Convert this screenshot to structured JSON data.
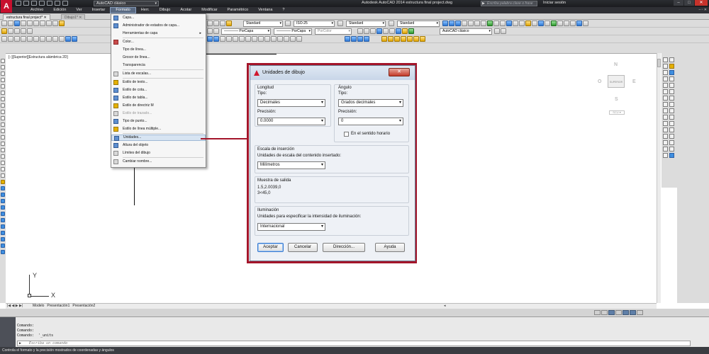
{
  "app": {
    "logo_letter": "A",
    "workspace": "AutoCAD clásico",
    "doc_title": "Autodesk AutoCAD 2014   estructura final project.dwg",
    "search_placeholder": "Escriba palabra clave o frase",
    "login": "Iniciar sesión",
    "win_min": "–",
    "win_max": "□",
    "win_close": "✕"
  },
  "menubar": {
    "items": [
      "Archivo",
      "Edición",
      "Ver",
      "Insertar",
      "Formato",
      "Herr.",
      "Dibujo",
      "Acotar",
      "Modificar",
      "Paramétrico",
      "Ventana",
      "?"
    ],
    "active_index": 4,
    "mdi_controls": "– ▫ ✕"
  },
  "doc_tabs": [
    {
      "label": "estructura final project*  ✕",
      "active": true
    },
    {
      "label": "Dibujo1*  ✕",
      "active": false
    }
  ],
  "toolbars": {
    "layer_combo": "———— PorCapa",
    "linetype_combo": "———— PorCapa",
    "color_combo": "PorColor",
    "text_style": "Standard",
    "dim_style": "ISO-25",
    "table_style": "Standard",
    "mleader_style": "Standard",
    "workspace_combo": "AutoCAD clásico"
  },
  "drawing": {
    "view_label": "[−][Superior][Estructura alámbrica 2D]",
    "ucs_x": "X",
    "ucs_y": "Y"
  },
  "navcube": {
    "top": "SUPERIOR",
    "n": "N",
    "s": "S",
    "e": "E",
    "o": "O",
    "wcs": "SCU ▾"
  },
  "layout_tabs": {
    "nav": "|◀ ◀ ▶ ▶|",
    "tabs": [
      "Modelo",
      "Presentación1",
      "Presentación2"
    ]
  },
  "command": {
    "lines": [
      "Comando:",
      "Comando:",
      "Comando:  '_units"
    ],
    "input_placeholder": "Escriba un comando",
    "input_icon": "▶"
  },
  "statusbar": {
    "text": "Controla el formato y la precisión mostrados de coordenadas y ángulos"
  },
  "formato_menu": {
    "items": [
      {
        "label": "Capa...",
        "icon": "t1"
      },
      {
        "label": "Administrador de estados de capa...",
        "icon": "t1"
      },
      {
        "label": "Herramientas de capa",
        "icon": "",
        "submenu": true
      },
      {
        "label": "Color...",
        "icon": "t4"
      },
      {
        "label": "Tipo de línea...",
        "icon": ""
      },
      {
        "label": "Grosor de línea...",
        "icon": ""
      },
      {
        "label": "Transparencia",
        "icon": ""
      },
      {
        "label": "Lista de escalas...",
        "icon": "t3"
      },
      {
        "label": "Estilo de texto...",
        "icon": "t2"
      },
      {
        "label": "Estilo de cota...",
        "icon": "t1"
      },
      {
        "label": "Estilo de tabla...",
        "icon": "t1"
      },
      {
        "label": "Estilo de directriz M",
        "icon": "t2"
      },
      {
        "label": "Estilo de trazado...",
        "icon": "t3",
        "disabled": true
      },
      {
        "label": "Tipo de punto...",
        "icon": "t1"
      },
      {
        "label": "Estilo de línea múltiple...",
        "icon": "t2"
      },
      {
        "label": "Unidades...",
        "icon": "t1",
        "highlight": true
      },
      {
        "label": "Altura del objeto",
        "icon": "t1"
      },
      {
        "label": "Límites del dibujo",
        "icon": "t3"
      },
      {
        "label": "Cambiar nombre...",
        "icon": "t3"
      }
    ]
  },
  "dialog": {
    "title": "Unidades de dibujo",
    "close_label": "✕",
    "length": {
      "heading": "Longitud",
      "type_label": "Tipo:",
      "type_value": "Decimales",
      "precision_label": "Precisión:",
      "precision_value": "0.0000"
    },
    "angle": {
      "heading": "Ángulo",
      "type_label": "Tipo:",
      "type_value": "Grados decimales",
      "precision_label": "Precisión:",
      "precision_value": "0",
      "clockwise_label": "En el sentido horario",
      "clockwise_checked": false
    },
    "insertion": {
      "heading": "Escala de inserción",
      "units_label": "Unidades de escala del contenido insertado:",
      "units_value": "Milímetros"
    },
    "sample": {
      "heading": "Muestra de salida",
      "line1": "1.5,2.0039,0",
      "line2": "3<45,0"
    },
    "lighting": {
      "heading": "Iluminación",
      "units_label": "Unidades para especificar la intensidad de iluminación:",
      "units_value": "Internacional"
    },
    "buttons": {
      "accept": "Aceptar",
      "cancel": "Cancelar",
      "direction": "Dirección...",
      "help": "Ayuda"
    }
  },
  "colors": {
    "accent_red": "#a4152a",
    "titlebar": "#2b2d31",
    "menu_highlight": "#d7e4f2"
  }
}
